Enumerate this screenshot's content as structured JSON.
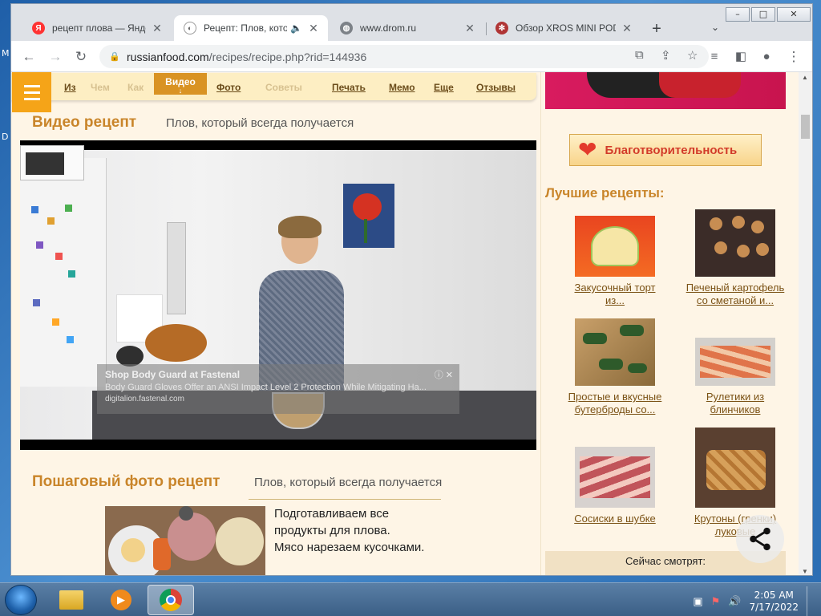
{
  "desktop": {
    "left_texts": [
      "M",
      "D"
    ]
  },
  "window": {
    "min": "–",
    "max": "□",
    "close": "✕"
  },
  "tabs": [
    {
      "title": "рецепт плова — Яндекс",
      "favicon": "yandex-icon",
      "fav_text": "Я"
    },
    {
      "title": "Рецепт: Плов, который",
      "favicon": "russianfood-icon"
    },
    {
      "title": "www.drom.ru",
      "favicon": "globe-icon"
    },
    {
      "title": "Обзор XROS MINI POD",
      "favicon": "xros-icon"
    }
  ],
  "toolbar": {
    "url_host": "russianfood.com",
    "url_path": "/recipes/recipe.php?rid=144936"
  },
  "site_menu": {
    "items": [
      "Из",
      "Чем",
      "Как",
      "Видео",
      "Фото",
      "Советы",
      "Печать",
      "Мемо",
      "Еще",
      "Отзывы"
    ],
    "active_arrow": "↓"
  },
  "video_section": {
    "title": "Видео рецепт",
    "subtitle": "Плов, который всегда получается"
  },
  "video_ad": {
    "title": "Shop Body Guard at Fastenal",
    "desc": "Body Guard Gloves Offer an ANSI Impact Level 2 Protection While Mitigating Ha...",
    "source": "digitalion.fastenal.com"
  },
  "photo_section": {
    "title": "Пошаговый фото рецепт",
    "subtitle": "Плов, который всегда получается",
    "step_text": [
      "Подготавливаем все",
      "продукты для плова.",
      "Мясо нарезаем кусочками."
    ]
  },
  "sidebar": {
    "charity": "Благотворительность",
    "best_title": "Лучшие рецепты:",
    "recipes": [
      {
        "line1": "Закусочный торт",
        "line2": "из..."
      },
      {
        "line1": "Печеный картофель",
        "line2": "со сметаной и..."
      },
      {
        "line1": "Простые и вкусные",
        "line2": "бутерброды со..."
      },
      {
        "line1": "Рулетики из",
        "line2": "блинчиков"
      },
      {
        "line1": "Сосиски в шубке",
        "line2": ""
      },
      {
        "line1": "Крутоны (гренки)",
        "line2": "луковые"
      }
    ],
    "now_watching": "Сейчас смотрят:"
  },
  "taskbar": {
    "time": "2:05 AM",
    "date": "7/17/2022"
  }
}
